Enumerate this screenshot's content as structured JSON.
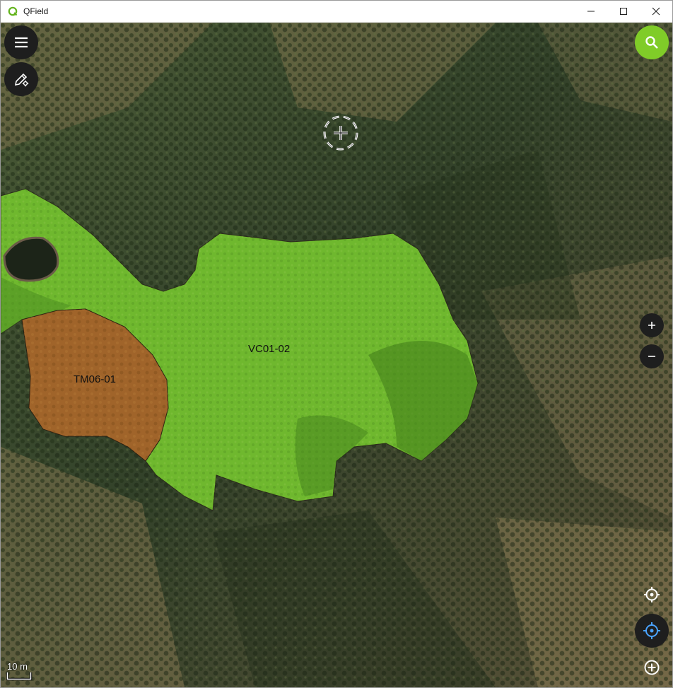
{
  "window": {
    "title": "QField"
  },
  "map": {
    "layers": [
      {
        "label": "VC01-02",
        "color": "#6fb82e"
      },
      {
        "label": "TM06-01",
        "color": "#a0642a"
      }
    ],
    "scale_label": "10 m"
  },
  "colors": {
    "accent": "#80cc28",
    "dark_button": "#1e1e1e",
    "location_blue": "#4aa3ff"
  },
  "icons": {
    "menu": "hamburger-menu-icon",
    "digitize": "pencil-settings-icon",
    "search": "search-icon",
    "crosshair": "crosshair-icon",
    "zoom_in": "plus-icon",
    "zoom_out": "minus-icon",
    "gnss": "gnss-crosshair-icon",
    "locate": "location-target-icon",
    "add": "add-circle-icon"
  }
}
